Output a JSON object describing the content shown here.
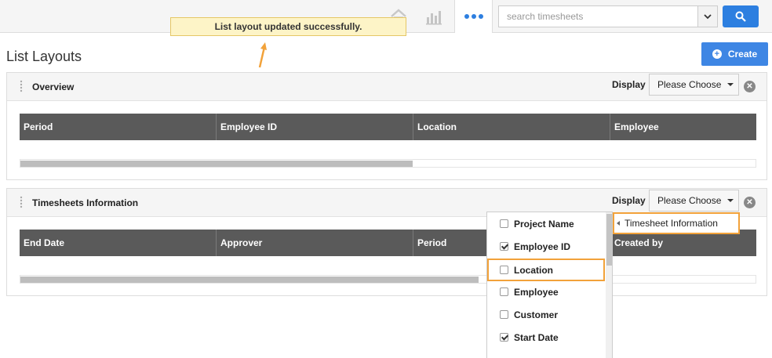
{
  "topbar": {
    "search_placeholder": "search timesheets",
    "icons": [
      "home-icon",
      "bar-chart-icon",
      "more-dots-icon",
      "chevron-down-icon",
      "search-icon"
    ]
  },
  "toast": {
    "message": "List layout updated successfully."
  },
  "page": {
    "title": "List Layouts",
    "create_label": "Create"
  },
  "panels": [
    {
      "title": "Overview",
      "display_label": "Display",
      "select_value": "Please Choose",
      "columns": [
        "Period",
        "Employee ID",
        "Location",
        "Employee"
      ]
    },
    {
      "title": "Timesheets Information",
      "display_label": "Display",
      "select_value": "Please Choose",
      "columns": [
        "End Date",
        "Approver",
        "Period",
        "Created by"
      ]
    }
  ],
  "menu": {
    "items": [
      {
        "label": "Project Name",
        "checked": false
      },
      {
        "label": "Employee ID",
        "checked": true
      },
      {
        "label": "Location",
        "checked": false
      },
      {
        "label": "Employee",
        "checked": false
      },
      {
        "label": "Customer",
        "checked": false
      },
      {
        "label": "Start Date",
        "checked": true
      }
    ],
    "submenu_label": "Timesheet Information"
  },
  "colors": {
    "accent": "#2d7fe0",
    "highlight": "#f2a23a",
    "header_bg": "#5a5a5a",
    "toast_bg": "#fdf4c7"
  }
}
